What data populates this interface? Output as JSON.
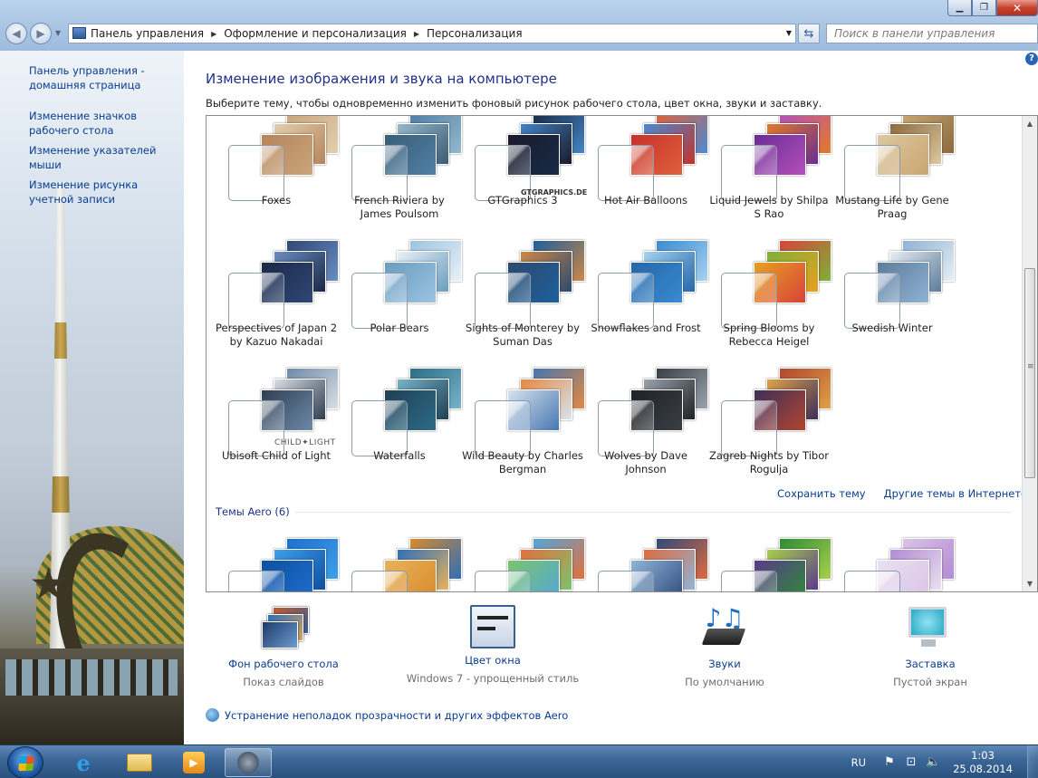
{
  "address": {
    "crumbs": [
      "Панель управления",
      "Оформление и персонализация",
      "Персонализация"
    ],
    "search_placeholder": "Поиск в панели управления"
  },
  "left": {
    "links": [
      "Панель управления - домашняя страница",
      "Изменение значков рабочего стола",
      "Изменение указателей мыши",
      "Изменение рисунка учетной записи"
    ]
  },
  "main": {
    "title": "Изменение изображения и звука на компьютере",
    "subtitle": "Выберите тему, чтобы одновременно изменить фоновый рисунок рабочего стола, цвет окна, звуки и заставку.",
    "themes": [
      {
        "name": "Foxes",
        "colors": [
          "#c9a57c",
          "#e2cfae",
          "#b6855a"
        ]
      },
      {
        "name": "French Riviera by James Poulsom",
        "colors": [
          "#4e7fa6",
          "#95b8cc",
          "#3b5d75"
        ]
      },
      {
        "name": "GTGraphics 3",
        "colors": [
          "#182b47",
          "#4484c7",
          "#1a1a2a"
        ],
        "brand": "GTGRAPHICS.DE"
      },
      {
        "name": "Hot Air Balloons",
        "colors": [
          "#e1603b",
          "#4b8ad0",
          "#c5322b"
        ]
      },
      {
        "name": "Liquid Jewels by Shilpa S Rao",
        "colors": [
          "#b34fbb",
          "#e37a2a",
          "#6a2c93"
        ]
      },
      {
        "name": "Mustang Life by Gene Praag",
        "colors": [
          "#c9a671",
          "#8c6a3f",
          "#dcc8a0"
        ]
      },
      {
        "name": "Perspectives of Japan 2 by Kazuo Nakadai",
        "colors": [
          "#2f4876",
          "#6a8ec1",
          "#1b2847"
        ]
      },
      {
        "name": "Polar Bears",
        "colors": [
          "#9cc3e0",
          "#e8f1f7",
          "#6a9dbf"
        ]
      },
      {
        "name": "Sights of Monterey by Suman Das",
        "colors": [
          "#1e5f9b",
          "#ce8747",
          "#2b4a6e"
        ]
      },
      {
        "name": "Snowflakes and Frost",
        "colors": [
          "#3b8ad1",
          "#a6d2f0",
          "#2467a8"
        ]
      },
      {
        "name": "Spring Blooms by Rebecca Heigel",
        "colors": [
          "#d7433a",
          "#7fb039",
          "#e8a020"
        ]
      },
      {
        "name": "Swedish Winter",
        "colors": [
          "#8fb2d3",
          "#e7eef5",
          "#5d7c9c"
        ]
      },
      {
        "name": "Ubisoft Child of Light",
        "colors": [
          "#6d8aa8",
          "#d8dee5",
          "#2f3e52"
        ],
        "brand2": "CHILD✦LIGHT"
      },
      {
        "name": "Waterfalls",
        "colors": [
          "#2d6b86",
          "#77b3c9",
          "#1e4054"
        ]
      },
      {
        "name": "Wild Beauty by Charles Bergman",
        "colors": [
          "#4676b0",
          "#e5883f",
          "#d8e3ef"
        ]
      },
      {
        "name": "Wolves by Dave Johnson",
        "colors": [
          "#3a3f44",
          "#9aa3ad",
          "#1f2226"
        ]
      },
      {
        "name": "Zagreb Nights by Tibor Rogulja",
        "colors": [
          "#b2452e",
          "#e0a146",
          "#3e2e5a"
        ]
      }
    ],
    "save_theme": "Сохранить тему",
    "more_themes": "Другие темы в Интернете",
    "aero_header": "Темы Aero (6)",
    "aero": [
      {
        "colors": [
          "#1e6fce",
          "#3ea0ea",
          "#0f4fa0"
        ]
      },
      {
        "colors": [
          "#d98a2b",
          "#2f6fb9",
          "#e8b35a"
        ]
      },
      {
        "colors": [
          "#52a7d9",
          "#e36f3f",
          "#7bc46c"
        ]
      },
      {
        "colors": [
          "#304a7a",
          "#e06a3e",
          "#8fb4d9"
        ]
      },
      {
        "colors": [
          "#2e8b37",
          "#a8d14a",
          "#5a3a8a"
        ]
      },
      {
        "colors": [
          "#d9c3e6",
          "#b38ad4",
          "#e9e1f1"
        ]
      }
    ]
  },
  "quick": [
    {
      "label": "Фон рабочего стола",
      "value": "Показ слайдов",
      "icon": "desktop-background-icon"
    },
    {
      "label": "Цвет окна",
      "value": "Windows 7 - упрощенный стиль",
      "icon": "window-color-icon"
    },
    {
      "label": "Звуки",
      "value": "По умолчанию",
      "icon": "sounds-icon"
    },
    {
      "label": "Заставка",
      "value": "Пустой экран",
      "icon": "screensaver-icon"
    }
  ],
  "troubleshoot": "Устранение неполадок прозрачности и других эффектов Aero",
  "tray": {
    "lang": "RU",
    "time": "1:03",
    "date": "25.08.2014"
  }
}
